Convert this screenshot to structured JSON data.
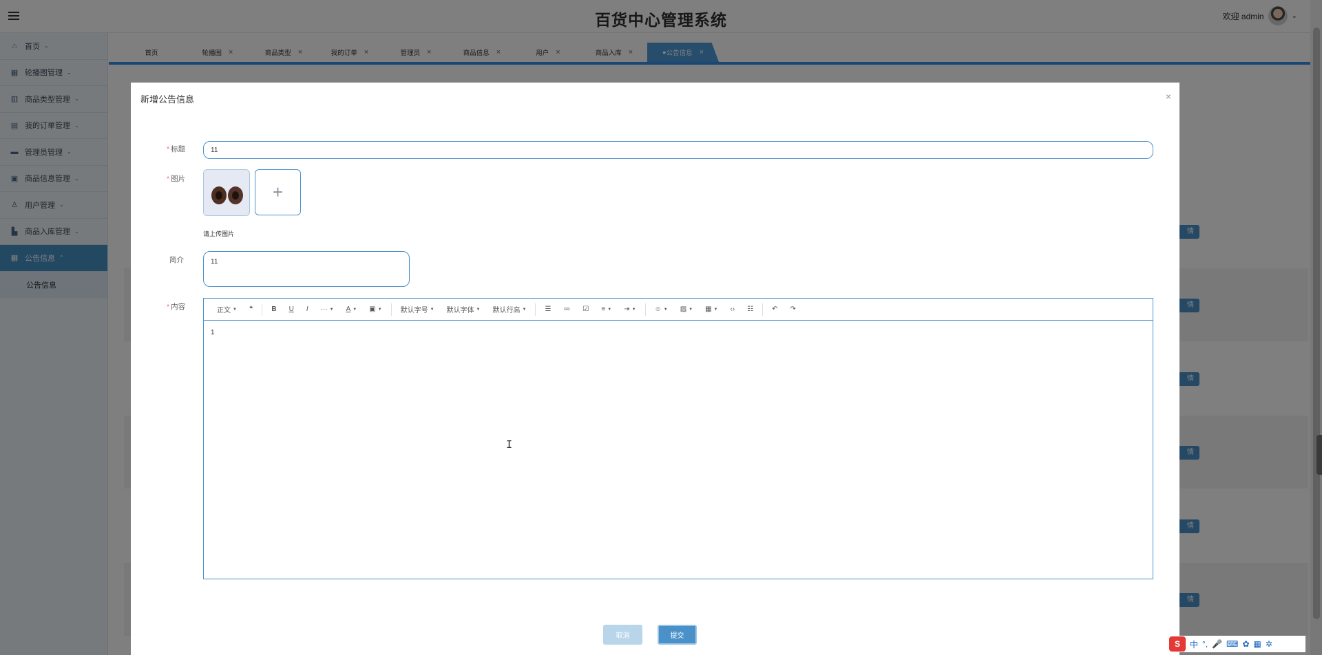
{
  "header": {
    "title": "百货中心管理系统",
    "welcome": "欢迎 admin"
  },
  "sidebar": {
    "items": [
      {
        "label": "首页",
        "icon": "home-icon"
      },
      {
        "label": "轮播图管理",
        "icon": "carousel-icon"
      },
      {
        "label": "商品类型管理",
        "icon": "shop-icon"
      },
      {
        "label": "我的订单管理",
        "icon": "order-icon"
      },
      {
        "label": "管理员管理",
        "icon": "admin-icon"
      },
      {
        "label": "商品信息管理",
        "icon": "product-icon"
      },
      {
        "label": "用户管理",
        "icon": "user-icon"
      },
      {
        "label": "商品入库管理",
        "icon": "warehouse-icon"
      },
      {
        "label": "公告信息",
        "icon": "notice-icon"
      }
    ],
    "submenu": "公告信息"
  },
  "tabs": [
    "首页",
    "轮播图",
    "商品类型",
    "我的订单",
    "管理员",
    "商品信息",
    "用户",
    "商品入库",
    "公告信息"
  ],
  "background": {
    "detail_button": "情"
  },
  "dialog": {
    "title": "新增公告信息",
    "close": "×",
    "fields": {
      "title_label": "标题",
      "title_value": "11",
      "image_label": "图片",
      "image_tip": "请上传图片",
      "intro_label": "简介",
      "intro_value": "11",
      "content_label": "内容",
      "content_value": "1"
    },
    "toolbar": {
      "paragraph": "正文",
      "font_size": "默认字号",
      "font_family": "默认字体",
      "line_height": "默认行高"
    },
    "buttons": {
      "cancel": "取消",
      "submit": "提交"
    }
  },
  "ime": {
    "lang": "中"
  }
}
